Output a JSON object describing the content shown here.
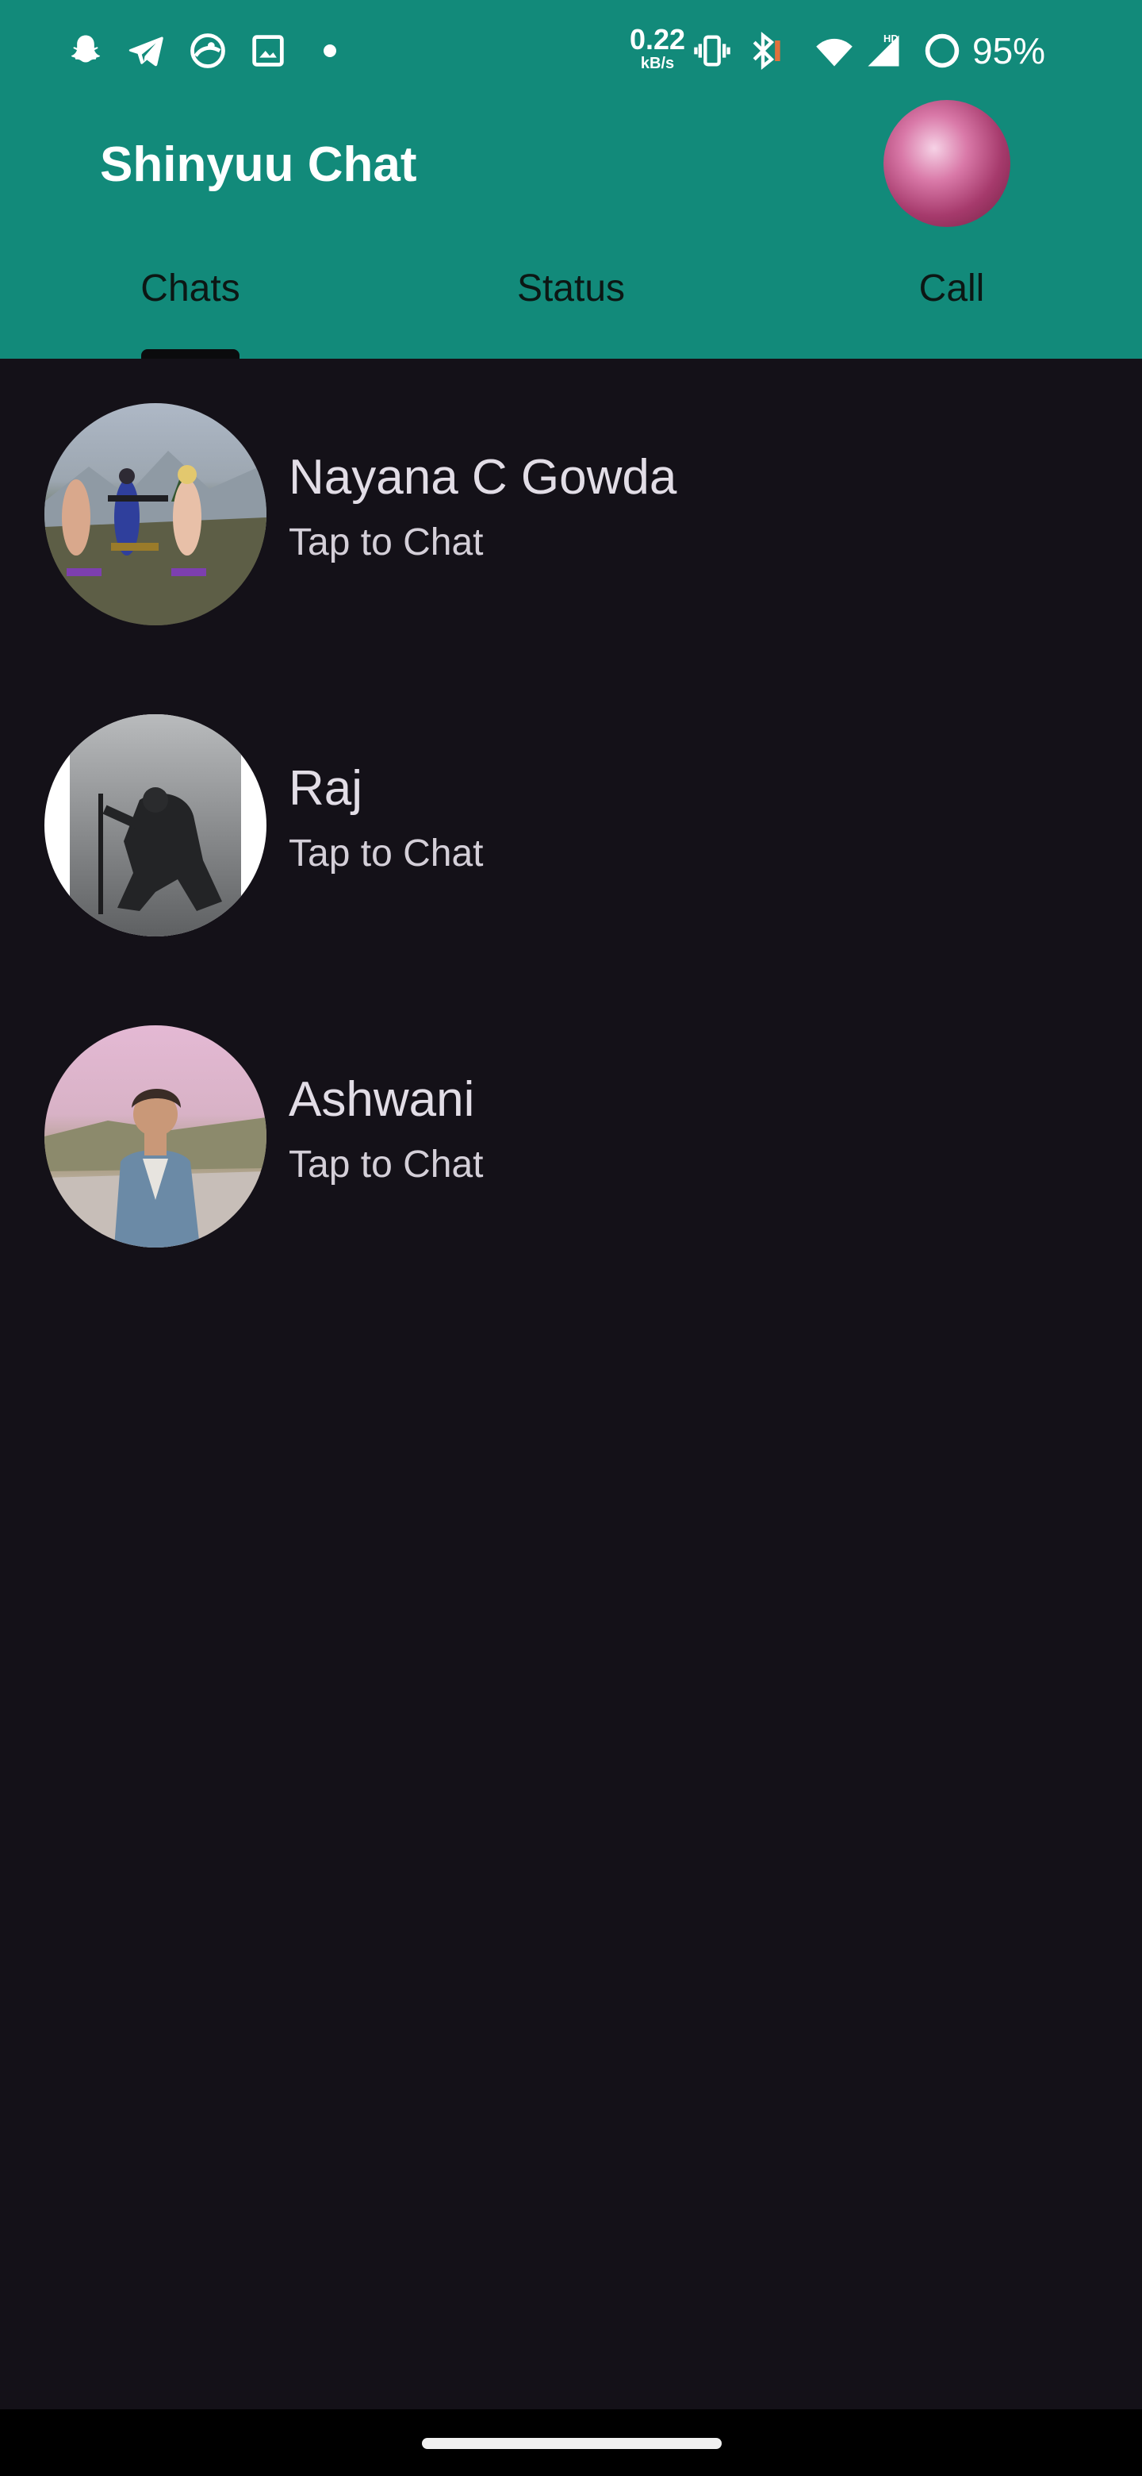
{
  "status_bar": {
    "net_speed_value": "0.22",
    "net_speed_unit": "kB/s",
    "battery_percent": "95%",
    "icons": [
      "snapchat-icon",
      "telegram-icon",
      "app-notification-icon",
      "gallery-icon",
      "vibrate-icon",
      "bluetooth-icon",
      "wifi-icon",
      "signal-hd-icon",
      "battery-ring-icon"
    ]
  },
  "app": {
    "title": "Shinyuu Chat",
    "accent_color": "#128a7a",
    "background_color": "#141118"
  },
  "tabs": [
    {
      "label": "Chats",
      "selected": true
    },
    {
      "label": "Status",
      "selected": false
    },
    {
      "label": "Call",
      "selected": false
    }
  ],
  "chats": [
    {
      "name": "Nayana C Gowda",
      "subtitle": "Tap to Chat"
    },
    {
      "name": "Raj",
      "subtitle": "Tap to Chat"
    },
    {
      "name": "Ashwani",
      "subtitle": "Tap to Chat"
    }
  ]
}
